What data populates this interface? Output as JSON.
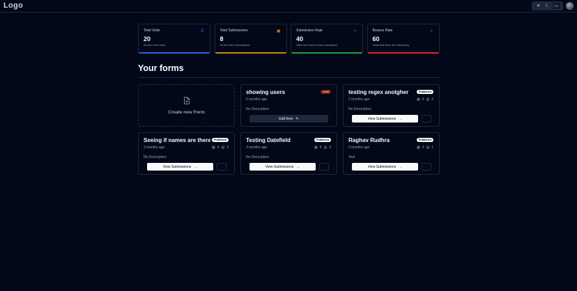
{
  "navbar": {
    "logo": "Logo",
    "theme_options": [
      {
        "icon": "sun-icon",
        "glyph": "☀"
      },
      {
        "icon": "moon-icon",
        "glyph": "☾"
      },
      {
        "icon": "monitor-icon",
        "glyph": "▭"
      }
    ]
  },
  "stats": [
    {
      "title": "Total Visits",
      "value": "20",
      "help": "All time form visits",
      "icon": "eye-icon",
      "glyph": "☰",
      "color": "#2563eb"
    },
    {
      "title": "Total Submissions",
      "value": "8",
      "help": "All time form submissions",
      "icon": "clipboard-icon",
      "glyph": "▣",
      "color": "#ca8a04"
    },
    {
      "title": "Submission Rate",
      "value": "40",
      "help": "Visits that result in form submission",
      "icon": "cursor-click-icon",
      "glyph": "↖",
      "color": "#16a34a"
    },
    {
      "title": "Bounce Rate",
      "value": "60",
      "help": "Visits that leave w/o interacting",
      "icon": "split-arrow-icon",
      "glyph": "⋎",
      "color": "#dc2626"
    }
  ],
  "section": {
    "title": "Your forms"
  },
  "create_form": {
    "label": "Create new Form"
  },
  "forms": [
    {
      "name": "showing users",
      "status": "Draft",
      "date": "2 months ago",
      "description": "No Description",
      "visits": "",
      "submissions": "",
      "action": "Edit form"
    },
    {
      "name": "testing regex anotgher",
      "status": "Published",
      "date": "2 months ago",
      "description": "No Description",
      "visits": "5",
      "submissions": "2",
      "action": "View Submissions"
    },
    {
      "name": "Seeing if names are there",
      "status": "Published",
      "date": "3 months ago",
      "description": "No Description",
      "visits": "4",
      "submissions": "3",
      "action": "View Submissions"
    },
    {
      "name": "Testing Datefield",
      "status": "Published",
      "date": "3 months ago",
      "description": "No Description",
      "visits": "6",
      "submissions": "2",
      "action": "View Submissions"
    },
    {
      "name": "Raghav Rudhra",
      "status": "Published",
      "date": "3 months ago",
      "description": "Test",
      "visits": "3",
      "submissions": "1",
      "action": "View Submissions"
    }
  ]
}
